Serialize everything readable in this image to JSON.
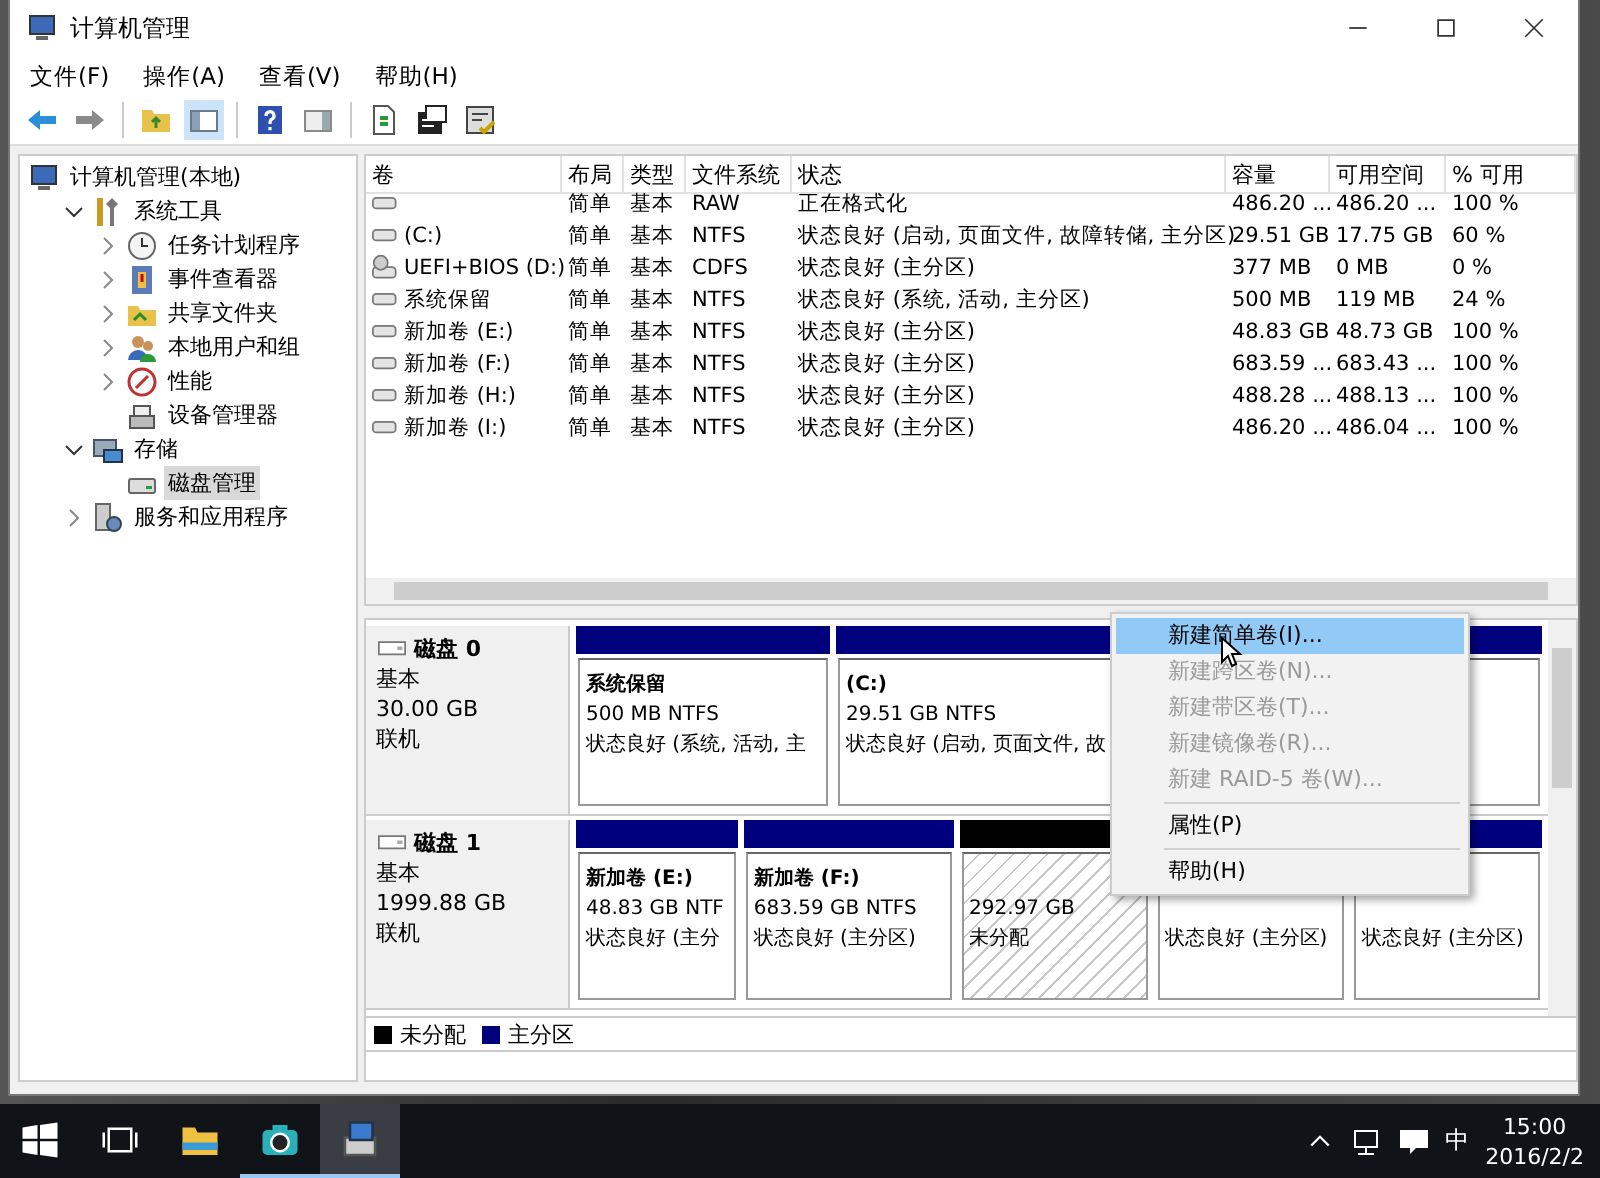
{
  "window": {
    "title": "计算机管理"
  },
  "menu_bar": [
    {
      "label": "文件(F)"
    },
    {
      "label": "操作(A)"
    },
    {
      "label": "查看(V)"
    },
    {
      "label": "帮助(H)"
    }
  ],
  "toolbar": [
    {
      "kind": "back",
      "pressed": false
    },
    {
      "kind": "forward",
      "pressed": false
    },
    {
      "kind": "separator"
    },
    {
      "kind": "up",
      "pressed": false
    },
    {
      "kind": "tree",
      "pressed": true
    },
    {
      "kind": "separator"
    },
    {
      "kind": "help",
      "pressed": false
    },
    {
      "kind": "pane",
      "pressed": false
    },
    {
      "kind": "separator"
    },
    {
      "kind": "export",
      "pressed": false
    },
    {
      "kind": "props",
      "pressed": false
    },
    {
      "kind": "settings",
      "pressed": false
    }
  ],
  "tree": [
    {
      "label": "计算机管理(本地)",
      "kind": "computer",
      "selected": false,
      "children": [
        {
          "label": "系统工具",
          "kind": "tools",
          "expanded": true,
          "selected": false,
          "children": [
            {
              "label": "任务计划程序",
              "kind": "clock",
              "expanded": false,
              "selected": false
            },
            {
              "label": "事件查看器",
              "kind": "event",
              "expanded": false,
              "selected": false
            },
            {
              "label": "共享文件夹",
              "kind": "share",
              "expanded": false,
              "selected": false
            },
            {
              "label": "本地用户和组",
              "kind": "users",
              "expanded": false,
              "selected": false
            },
            {
              "label": "性能",
              "kind": "perf",
              "expanded": false,
              "selected": false
            },
            {
              "label": "设备管理器",
              "kind": "device",
              "selected": false
            }
          ]
        },
        {
          "label": "存储",
          "kind": "storage",
          "expanded": true,
          "selected": false,
          "children": [
            {
              "label": "磁盘管理",
              "kind": "disk",
              "selected": true
            }
          ]
        },
        {
          "label": "服务和应用程序",
          "kind": "services",
          "expanded": false,
          "selected": false
        }
      ]
    }
  ],
  "table": {
    "columns": [
      "卷",
      "布局",
      "类型",
      "文件系统",
      "状态",
      "容量",
      "可用空间",
      "% 可用"
    ],
    "rows": [
      {
        "kind": "disk",
        "layout": "简单",
        "type": "基本",
        "fs": "RAW",
        "status": "正在格式化",
        "capacity": "486.20 ...",
        "free": "486.20 ...",
        "pct": "100 %"
      },
      {
        "kind": "disk",
        "volume": "(C:)",
        "layout": "简单",
        "type": "基本",
        "fs": "NTFS",
        "status": "状态良好 (启动, 页面文件, 故障转储, 主分区)",
        "capacity": "29.51 GB",
        "free": "17.75 GB",
        "pct": "60 %"
      },
      {
        "kind": "cdrom",
        "volume": "UEFI+BIOS (D:)",
        "layout": "简单",
        "type": "基本",
        "fs": "CDFS",
        "status": "状态良好 (主分区)",
        "capacity": "377 MB",
        "free": "0 MB",
        "pct": "0 %"
      },
      {
        "kind": "disk",
        "volume": "系统保留",
        "layout": "简单",
        "type": "基本",
        "fs": "NTFS",
        "status": "状态良好 (系统, 活动, 主分区)",
        "capacity": "500 MB",
        "free": "119 MB",
        "pct": "24 %"
      },
      {
        "kind": "disk",
        "volume": "新加卷 (E:)",
        "layout": "简单",
        "type": "基本",
        "fs": "NTFS",
        "status": "状态良好 (主分区)",
        "capacity": "48.83 GB",
        "free": "48.73 GB",
        "pct": "100 %"
      },
      {
        "kind": "disk",
        "volume": "新加卷 (F:)",
        "layout": "简单",
        "type": "基本",
        "fs": "NTFS",
        "status": "状态良好 (主分区)",
        "capacity": "683.59 ...",
        "free": "683.43 ...",
        "pct": "100 %"
      },
      {
        "kind": "disk",
        "volume": "新加卷 (H:)",
        "layout": "简单",
        "type": "基本",
        "fs": "NTFS",
        "status": "状态良好 (主分区)",
        "capacity": "488.28 ...",
        "free": "488.13 ...",
        "pct": "100 %"
      },
      {
        "kind": "disk",
        "volume": "新加卷 (I:)",
        "layout": "简单",
        "type": "基本",
        "fs": "NTFS",
        "status": "状态良好 (主分区)",
        "capacity": "486.20 ...",
        "free": "486.04 ...",
        "pct": "100 %"
      }
    ]
  },
  "disks": [
    {
      "name": "磁盘 0",
      "type": "基本",
      "size": "30.00 GB",
      "status": "联机",
      "partitions": [
        {
          "kind": "primary",
          "name": "系统保留",
          "size": "500 MB NTFS",
          "status": "状态良好 (系统, 活动, 主"
        },
        {
          "kind": "primary",
          "name": "(C:)",
          "size": "29.51 GB NTFS",
          "status": "状态良好 (启动, 页面文件, 故"
        }
      ]
    },
    {
      "name": "磁盘 1",
      "type": "基本",
      "size": "1999.88 GB",
      "status": "联机",
      "partitions": [
        {
          "kind": "primary",
          "name": "新加卷  (E:)",
          "size": "48.83 GB NTF",
          "status": "状态良好 (主分"
        },
        {
          "kind": "primary",
          "name": "新加卷  (F:)",
          "size": "683.59 GB NTFS",
          "status": "状态良好 (主分区)"
        },
        {
          "kind": "unallocated",
          "size": "292.97 GB",
          "status": "未分配"
        },
        {
          "kind": "primary",
          "status": "状态良好 (主分区)"
        },
        {
          "kind": "primary",
          "status": "状态良好 (主分区)"
        }
      ]
    }
  ],
  "legend": [
    {
      "label": "未分配",
      "color": "#000000"
    },
    {
      "label": "主分区",
      "color": "#00007f"
    }
  ],
  "context_menu": [
    {
      "kind": "item",
      "label": "新建简单卷(I)...",
      "disabled": false,
      "selected": true
    },
    {
      "kind": "item",
      "label": "新建跨区卷(N)...",
      "disabled": true,
      "selected": false
    },
    {
      "kind": "item",
      "label": "新建带区卷(T)...",
      "disabled": true,
      "selected": false
    },
    {
      "kind": "item",
      "label": "新建镜像卷(R)...",
      "disabled": true,
      "selected": false
    },
    {
      "kind": "item",
      "label": "新建 RAID-5 卷(W)...",
      "disabled": true,
      "selected": false
    },
    {
      "kind": "separator"
    },
    {
      "kind": "item",
      "label": "属性(P)",
      "disabled": false,
      "selected": false
    },
    {
      "kind": "separator"
    },
    {
      "kind": "item",
      "label": "帮助(H)",
      "disabled": false,
      "selected": false
    }
  ],
  "taskbar": {
    "items": [
      {
        "kind": "start"
      },
      {
        "kind": "taskview"
      },
      {
        "kind": "explorer",
        "running": false,
        "active": false
      },
      {
        "kind": "camera",
        "running": true,
        "active": false
      },
      {
        "kind": "diskmgmt",
        "running": true,
        "active": true
      }
    ],
    "ime": "中",
    "time": "15:00",
    "date": "2016/2/2"
  }
}
